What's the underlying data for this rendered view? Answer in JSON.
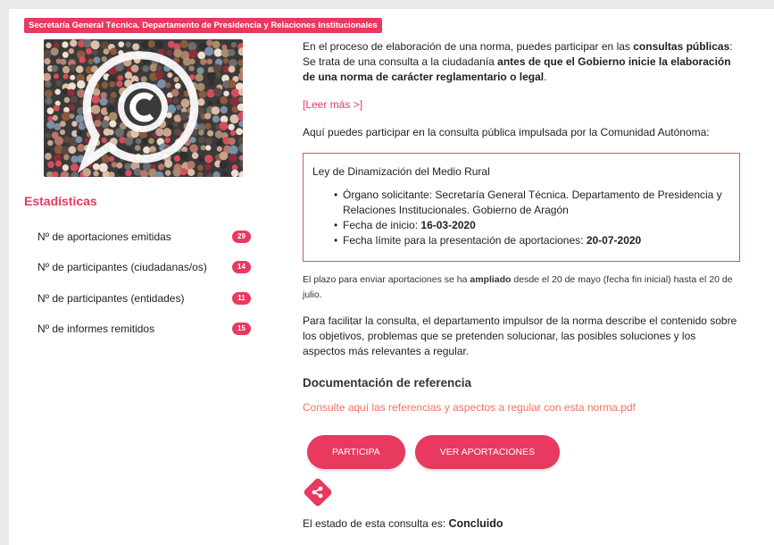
{
  "department_tag": "Secretaría General Técnica. Departamento de Presidencia y Relaciones Institucionales",
  "stats": {
    "title": "Estadísticas",
    "items": [
      {
        "label": "Nº de aportaciones emitidas",
        "count": "29"
      },
      {
        "label": "Nº de participantes (ciudadanas/os)",
        "count": "14"
      },
      {
        "label": "Nº de participantes (entidades)",
        "count": "11"
      },
      {
        "label": "Nº de informes remitidos",
        "count": "15"
      }
    ]
  },
  "intro": {
    "part1": "En el proceso de elaboración de una norma, puedes participar en las ",
    "bold1": "consultas públicas",
    "part2": ": Se trata de una consulta a la ciudadanía ",
    "bold2": "antes de que el Gobierno inicie la elaboración de una norma de carácter reglamentario o legal",
    "part3": "."
  },
  "read_more": "[Leer más >]",
  "consult_intro": "Aquí puedes participar en la consulta pública impulsada por la Comunidad Autónoma:",
  "box": {
    "title": "Ley de Dinamización del Medio Rural",
    "organ_label": "Órgano solicitante: ",
    "organ_value": "Secretaría General Técnica. Departamento de Presidencia y Relaciones Institucionales. Gobierno de Aragón",
    "start_label": "Fecha de inicio: ",
    "start_value": "16-03-2020",
    "deadline_label": "Fecha límite para la presentación de aportaciones: ",
    "deadline_value": "20-07-2020"
  },
  "note": {
    "part1": "El plazo para enviar aportaciones se ha ",
    "bold": "ampliado",
    "part2": " desde el 20 de mayo (fecha fin inicial) hasta el 20 de julio."
  },
  "description": "Para facilitar la consulta, el departamento impulsor de la norma describe el contenido sobre los objetivos, problemas que se pretenden solucionar, las posibles soluciones y los aspectos más relevantes a regular.",
  "documentation": {
    "title": "Documentación de referencia",
    "link": "Consulte aquí las referencias y aspectos a regular con esta norma.pdf"
  },
  "buttons": {
    "participate": "PARTICIPA",
    "view": "VER APORTACIONES"
  },
  "share_icon": "share-icon",
  "status": {
    "label": "El estado de esta consulta es: ",
    "value": "Concluido"
  },
  "colors": {
    "accent": "#e8395f",
    "link": "#f2735a"
  }
}
